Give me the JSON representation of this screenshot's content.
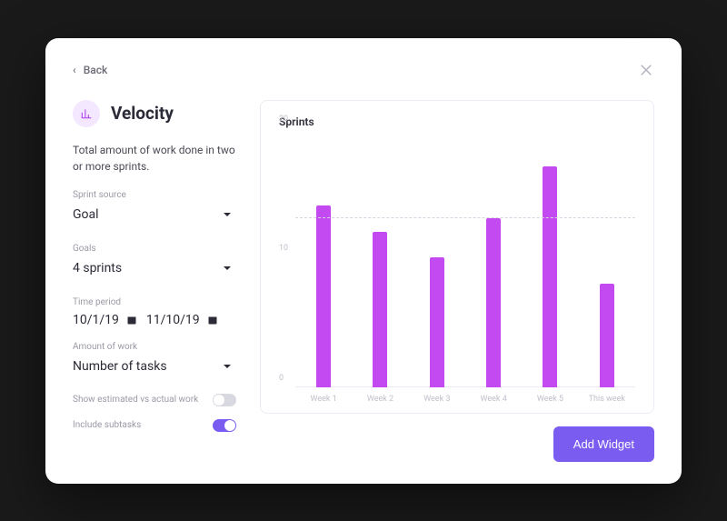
{
  "back_label": "Back",
  "title": "Velocity",
  "description": "Total amount of work done in two or more sprints.",
  "fields": {
    "sprint_source": {
      "label": "Sprint source",
      "value": "Goal"
    },
    "goals": {
      "label": "Goals",
      "value": "4 sprints"
    },
    "time_period": {
      "label": "Time period",
      "start": "10/1/19",
      "end": "11/10/19"
    },
    "amount_of_work": {
      "label": "Amount of work",
      "value": "Number of tasks"
    }
  },
  "toggles": {
    "estimated_vs_actual": {
      "label": "Show estimated vs actual work",
      "on": false
    },
    "include_subtasks": {
      "label": "Include subtasks",
      "on": true
    }
  },
  "chart_title": "Sprints",
  "chart_data": {
    "type": "bar",
    "title": "Sprints",
    "categories": [
      "Week 1",
      "Week 2",
      "Week 3",
      "Week 4",
      "Week 5",
      "This week"
    ],
    "values": [
      14,
      12,
      10,
      13,
      17,
      8
    ],
    "xlabel": "",
    "ylabel": "",
    "ylim": [
      0,
      20
    ],
    "yticks": [
      0,
      10,
      20
    ],
    "reference_line": 13
  },
  "add_widget_label": "Add Widget",
  "colors": {
    "accent": "#7a5cf0",
    "bar": "#c24af0"
  }
}
